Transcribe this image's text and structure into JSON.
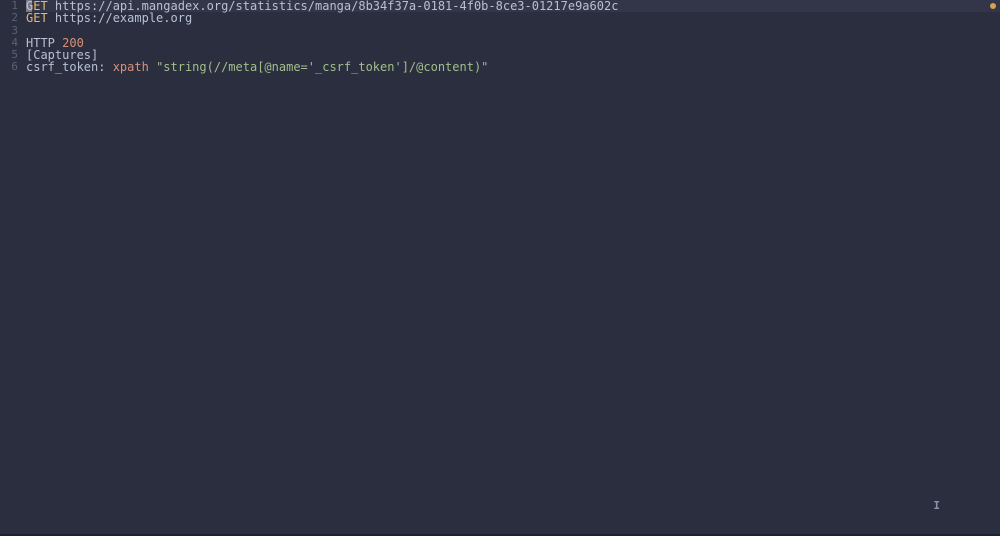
{
  "lines": [
    {
      "number": "1",
      "segments": [
        {
          "text": "GET",
          "class": "method"
        },
        {
          "text": " https://api.mangadex.org/statistics/manga/8b34f37a-0181-4f0b-8ce3-01217e9a602c",
          "class": "url"
        }
      ],
      "hasCursor": true
    },
    {
      "number": "2",
      "segments": [
        {
          "text": "GET",
          "class": "method"
        },
        {
          "text": " https://example.org",
          "class": "url"
        }
      ]
    },
    {
      "number": "3",
      "segments": []
    },
    {
      "number": "4",
      "segments": [
        {
          "text": "HTTP ",
          "class": "http"
        },
        {
          "text": "200",
          "class": "status"
        }
      ]
    },
    {
      "number": "5",
      "segments": [
        {
          "text": "[Captures]",
          "class": "section"
        }
      ]
    },
    {
      "number": "6",
      "segments": [
        {
          "text": "csrf_token",
          "class": "key"
        },
        {
          "text": ": ",
          "class": "colon"
        },
        {
          "text": "xpath",
          "class": "function"
        },
        {
          "text": " ",
          "class": "colon"
        },
        {
          "text": "\"string(//meta[@name='_csrf_token']/@content)\"",
          "class": "string"
        }
      ]
    }
  ],
  "textCursorGlyph": "I"
}
